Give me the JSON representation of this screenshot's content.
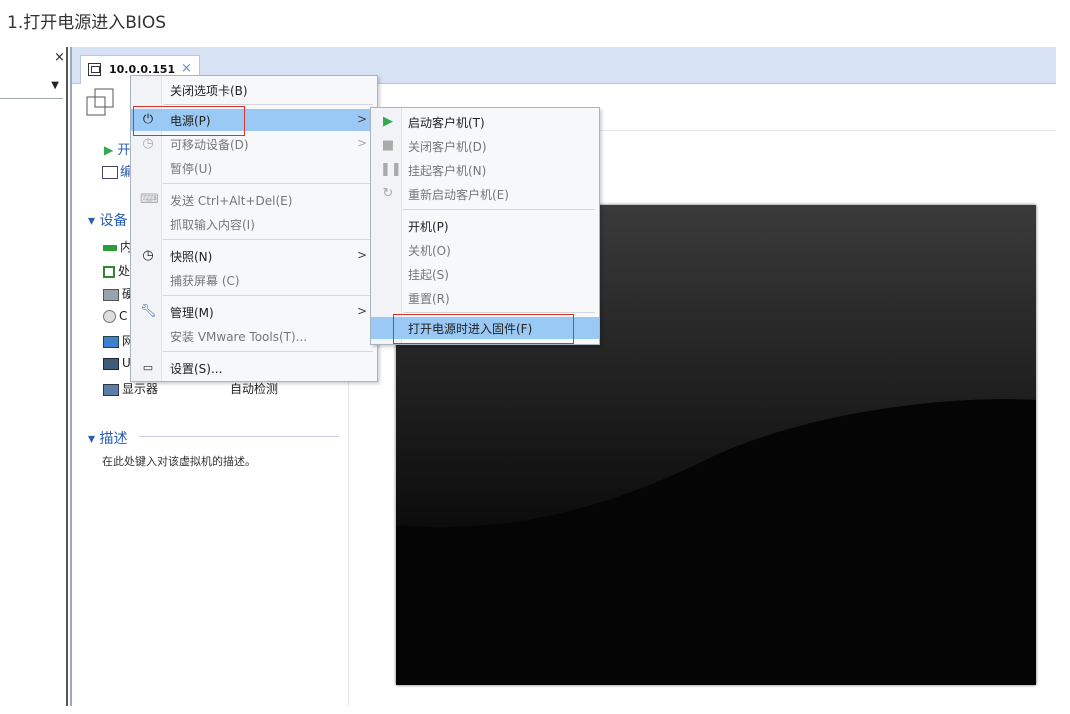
{
  "doc_heading": "1.打开电源进入BIOS",
  "left_panel": {
    "close_glyph": "×",
    "dropdown_arrow": "▼"
  },
  "tab": {
    "label": "10.0.0.151",
    "close_glyph": "×",
    "icon": "vm-tab-icon"
  },
  "summary": {
    "power_on_partial": "开",
    "edit_partial": "编",
    "devices_heading": "设备",
    "devices": [
      {
        "label": "内",
        "icon": "memory-icon"
      },
      {
        "label": "处",
        "icon": "processor-icon"
      },
      {
        "label": "硬",
        "icon": "harddisk-icon"
      },
      {
        "label": "C",
        "icon": "cd-icon"
      },
      {
        "label": "网",
        "icon": "network-icon"
      },
      {
        "label": "U",
        "icon": "usb-icon"
      }
    ],
    "display": {
      "label": "显示器",
      "value": "自动检测"
    },
    "desc_heading": "描述",
    "desc_text": "在此处键入对该虚拟机的描述。"
  },
  "context_menu": {
    "items": [
      {
        "label": "关闭选项卡(B)",
        "icon": ""
      },
      {
        "label": "电源(P)",
        "icon": "power-icon",
        "submenu": true
      },
      {
        "label": "可移动设备(D)",
        "icon": "removable-device-icon",
        "submenu": true,
        "disabled": true
      },
      {
        "label": "暂停(U)",
        "disabled": true
      },
      {
        "label": "发送 Ctrl+Alt+Del(E)",
        "icon": "send-keys-icon",
        "disabled": true
      },
      {
        "label": "抓取输入内容(I)",
        "disabled": true
      },
      {
        "label": "快照(N)",
        "icon": "snapshot-icon",
        "submenu": true
      },
      {
        "label": "捕获屏幕 (C)",
        "disabled": true
      },
      {
        "label": "管理(M)",
        "icon": "wrench-icon",
        "submenu": true
      },
      {
        "label": "安装 VMware Tools(T)...",
        "disabled": true
      },
      {
        "label": "设置(S)...",
        "icon": "settings-icon"
      }
    ],
    "submenu_arrow": ">"
  },
  "power_submenu": {
    "items": [
      {
        "label": "启动客户机(T)",
        "icon": "play-icon"
      },
      {
        "label": "关闭客户机(D)",
        "icon": "stop-icon",
        "disabled": true
      },
      {
        "label": "挂起客户机(N)",
        "icon": "pause-icon",
        "disabled": true
      },
      {
        "label": "重新启动客户机(E)",
        "icon": "restart-icon",
        "disabled": true
      },
      {
        "label": "开机(P)"
      },
      {
        "label": "关机(O)",
        "disabled": true
      },
      {
        "label": "挂起(S)",
        "disabled": true
      },
      {
        "label": "重置(R)",
        "disabled": true
      },
      {
        "label": "打开电源时进入固件(F)",
        "highlighted": true
      }
    ]
  },
  "colors": {
    "accent_blue": "#2a5db0",
    "menu_highlight": "#99c9f4",
    "annotation_red": "#d9342b",
    "play_green": "#34a853",
    "tabbar": "#d7e3f4"
  }
}
